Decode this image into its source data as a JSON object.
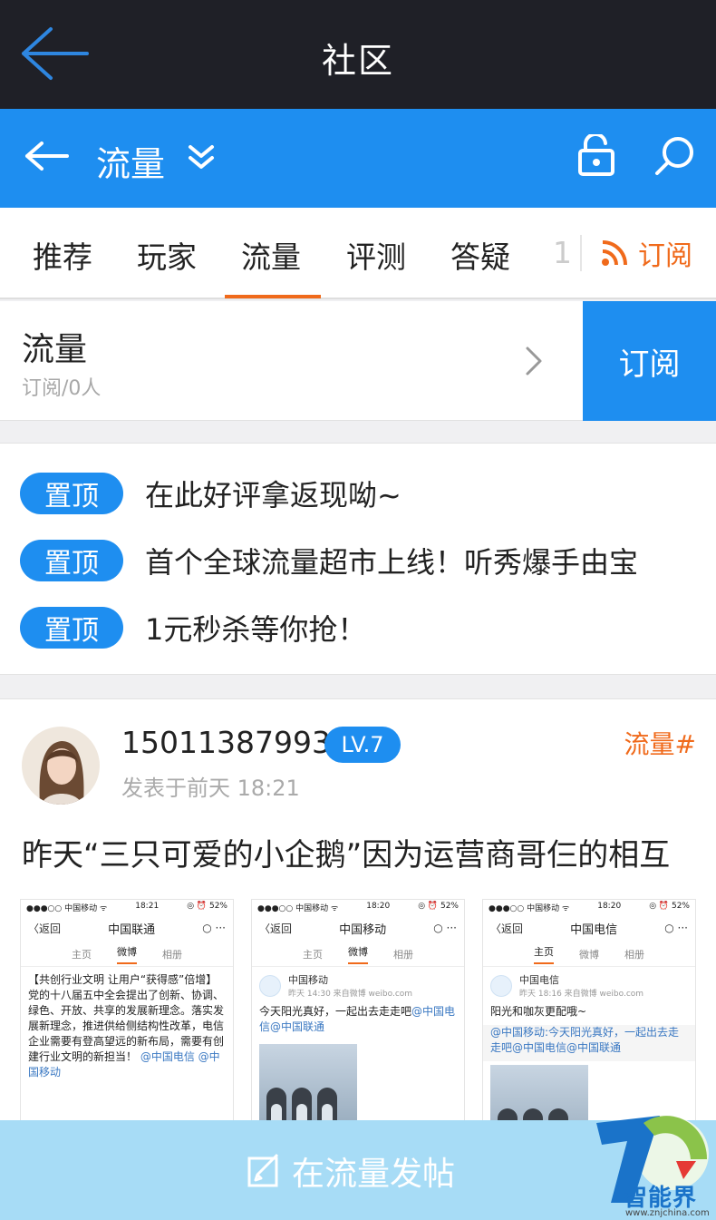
{
  "topbar": {
    "title": "社区"
  },
  "channel_bar": {
    "title": "流量"
  },
  "tabs": [
    {
      "label": "推荐"
    },
    {
      "label": "玩家"
    },
    {
      "label": "流量"
    },
    {
      "label": "评测"
    },
    {
      "label": "答疑"
    }
  ],
  "tab_overflow": "1",
  "subscribe_tab": "订阅",
  "channel": {
    "name": "流量",
    "subscribers": "订阅/0人",
    "subscribe_button": "订阅"
  },
  "pinned": [
    {
      "badge": "置顶",
      "text": "在此好评拿返现呦~"
    },
    {
      "badge": "置顶",
      "text": "首个全球流量超市上线！听秀爆手由宝"
    },
    {
      "badge": "置顶",
      "text": "1元秒杀等你抢！"
    }
  ],
  "post": {
    "username": "15011387993",
    "level": "LV.7",
    "topic": "流量#",
    "time": "发表于前天 18:21",
    "title": "昨天“三只可爱的小企鹅”因为运营商哥仨的相互",
    "shots": [
      {
        "status_left": "●●●○○ 中国移动 ᯤ",
        "status_time": "18:21",
        "status_right": "◎ ⏰ 52%",
        "back": "〈返回",
        "title": "中国联通",
        "tabs": [
          "主页",
          "微博",
          "相册"
        ],
        "body": "【共创行业文明 让用户“获得感”倍增】党的十八届五中全会提出了创新、协调、绿色、开放、共享的发展新理念。落实发展新理念，推进供给侧结构性改革，电信企业需要有登高望远的新布局，需要有创建行业文明的新担当！",
        "mention": "@中国电信 @中国移动"
      },
      {
        "status_left": "●●●○○ 中国移动 ᯤ",
        "status_time": "18:20",
        "status_right": "◎ ⏰ 52%",
        "back": "〈返回",
        "title": "中国移动",
        "tabs": [
          "主页",
          "微博",
          "相册"
        ],
        "account": "中国移动",
        "meta": "昨天 14:30 来自微博 weibo.com",
        "body": "今天阳光真好，一起出去走走吧",
        "mention": "@中国电信@中国联通"
      },
      {
        "status_left": "●●●○○ 中国移动 ᯤ",
        "status_time": "18:20",
        "status_right": "◎ ⏰ 52%",
        "back": "〈返回",
        "title": "中国电信",
        "tabs": [
          "主页",
          "微博",
          "相册"
        ],
        "account": "中国电信",
        "meta": "昨天 18:16 来自微博 weibo.com",
        "body": "阳光和咖灰更配哦~",
        "mention": "@中国移动:今天阳光真好，一起出去走走吧@中国电信@中国联通"
      }
    ]
  },
  "compose": {
    "label": "在流量发帖"
  },
  "watermark": {
    "name": "智能界",
    "url": "www.znjchina.com"
  },
  "colors": {
    "dark": "#1f2027",
    "blue": "#1e8ef0",
    "orange": "#f06a1b",
    "compose": "#a7dcf6"
  }
}
